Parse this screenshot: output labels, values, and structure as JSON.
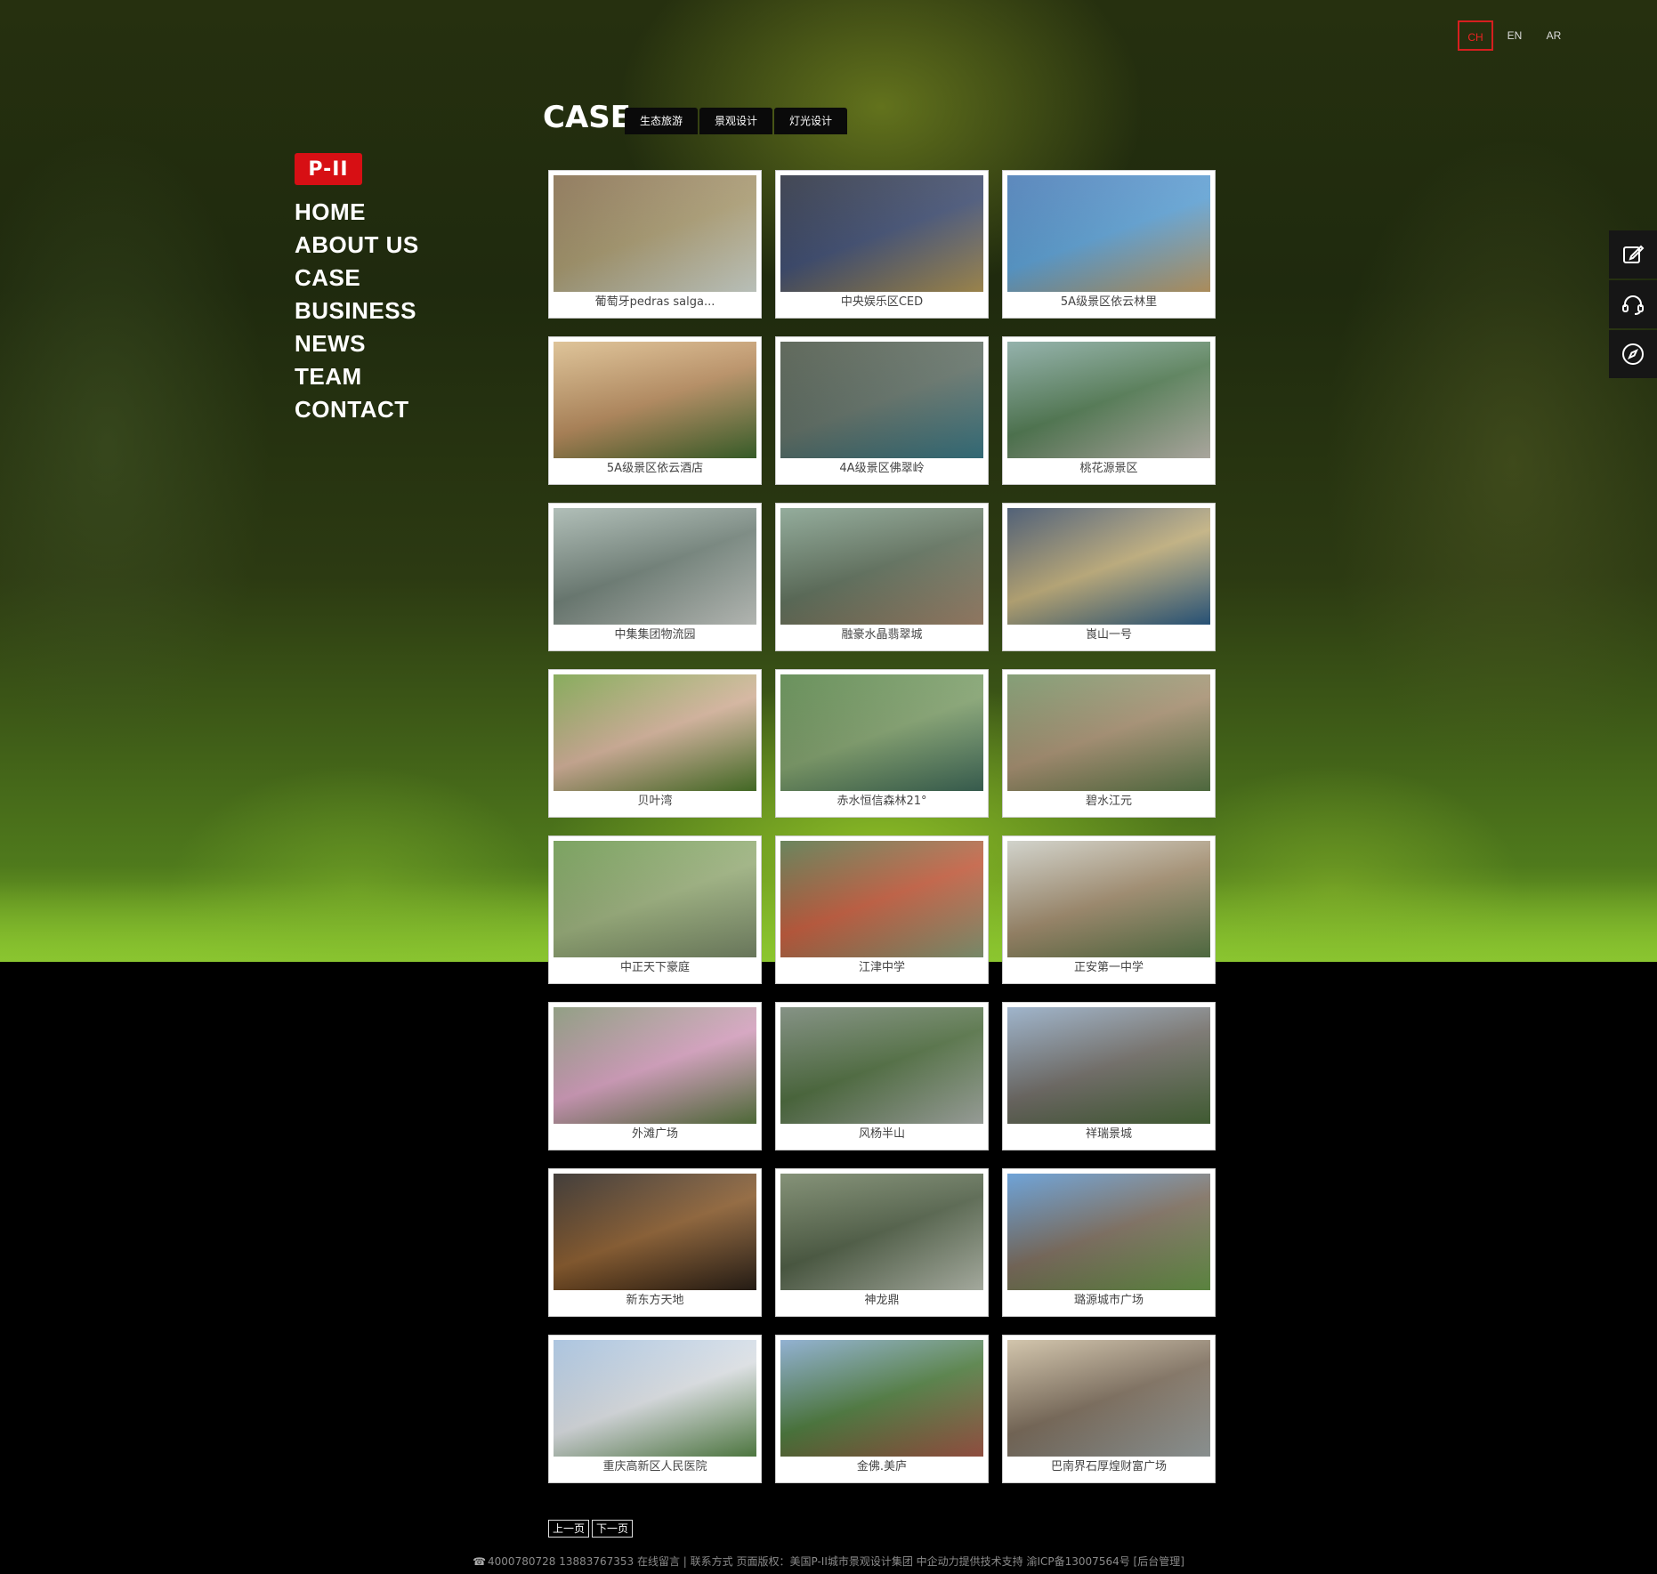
{
  "lang": [
    {
      "label": "CH",
      "active": true
    },
    {
      "label": "EN",
      "active": false
    },
    {
      "label": "AR",
      "active": false
    }
  ],
  "logo": {
    "text": "P-II"
  },
  "nav": {
    "items": [
      "HOME",
      "ABOUT US",
      "CASE",
      "BUSINESS",
      "NEWS",
      "TEAM",
      "CONTACT"
    ]
  },
  "case": {
    "title": "CASE",
    "tabs": [
      "生态旅游",
      "景观设计",
      "灯光设计"
    ]
  },
  "cards": [
    {
      "caption": "葡萄牙pedras salga...",
      "colors": [
        "#7c6240",
        "#a99a6e",
        "#d8e0d8"
      ]
    },
    {
      "caption": "中央娱乐区CED",
      "colors": [
        "#1a2030",
        "#3b4a70",
        "#b59a58"
      ]
    },
    {
      "caption": "5A级景区依云林里",
      "colors": [
        "#3a6fae",
        "#5aa1d7",
        "#c9a46a"
      ]
    },
    {
      "caption": "5A级景区依云酒店",
      "colors": [
        "#d7b783",
        "#b88a5a",
        "#3f6b2f"
      ]
    },
    {
      "caption": "4A级景区佛翠岭",
      "colors": [
        "#3f4a3a",
        "#5e6e64",
        "#3a7a88"
      ]
    },
    {
      "caption": "桃花源景区",
      "colors": [
        "#7da19a",
        "#4f7a50",
        "#c7c2b8"
      ]
    },
    {
      "caption": "中集集团物流园",
      "colors": [
        "#9fb0a8",
        "#6e7f76",
        "#d0d4cf"
      ]
    },
    {
      "caption": "融豪水晶翡翠城",
      "colors": [
        "#7c9a86",
        "#5d6f5a",
        "#a88a70"
      ]
    },
    {
      "caption": "崀山一号",
      "colors": [
        "#2c3f5a",
        "#c3b07a",
        "#2d5f8a"
      ]
    },
    {
      "caption": "贝叶湾",
      "colors": [
        "#6e9a3a",
        "#d7b39a",
        "#4d7a2a"
      ]
    },
    {
      "caption": "赤水恒信森林21°",
      "colors": [
        "#4a7a3a",
        "#7fa06a",
        "#3f6a5a"
      ]
    },
    {
      "caption": "碧水江元",
      "colors": [
        "#6a8a5a",
        "#a89070",
        "#5a7a48"
      ]
    },
    {
      "caption": "中正天下豪庭",
      "colors": [
        "#5f8f3f",
        "#9ab07a",
        "#7a8a6a"
      ]
    },
    {
      "caption": "江津中学",
      "colors": [
        "#4a6a3a",
        "#c65a3a",
        "#8aa07a"
      ]
    },
    {
      "caption": "正安第一中学",
      "colors": [
        "#c7c9c0",
        "#a08a6a",
        "#5a7a4a"
      ]
    },
    {
      "caption": "外滩广场",
      "colors": [
        "#7a8a6a",
        "#d8a0c0",
        "#5a7a40"
      ]
    },
    {
      "caption": "风杨半山",
      "colors": [
        "#6a7a6a",
        "#4a6a3a",
        "#b0b6b0"
      ]
    },
    {
      "caption": "祥瑞景城",
      "colors": [
        "#8aa4c0",
        "#6e6a64",
        "#4a6a3a"
      ]
    },
    {
      "caption": "新东方天地",
      "colors": [
        "#1a1410",
        "#8a5a2a",
        "#2a2018"
      ]
    },
    {
      "caption": "神龙鼎",
      "colors": [
        "#6a7a5a",
        "#4a5a40",
        "#c0c6b8"
      ]
    },
    {
      "caption": "璐源城市广场",
      "colors": [
        "#4f8fcf",
        "#7a6a5a",
        "#6a9a4a"
      ]
    },
    {
      "caption": "重庆高新区人民医院",
      "colors": [
        "#9ab8d8",
        "#e0e4e8",
        "#5a8a4a"
      ]
    },
    {
      "caption": "金佛.美庐",
      "colors": [
        "#7aa0c8",
        "#4a7a3a",
        "#a85a4a"
      ]
    },
    {
      "caption": "巴南界石厚煌财富广场",
      "colors": [
        "#c8b89a",
        "#7a6a58",
        "#a0a8a8"
      ]
    }
  ],
  "tools": [
    {
      "icon": "edit-icon"
    },
    {
      "icon": "headset-icon"
    },
    {
      "icon": "compass-icon"
    }
  ],
  "pager": {
    "prev": "上一页",
    "next": "下一页"
  },
  "footer": {
    "text": "4000780728 13883767353 在线留言 | 联系方式  页面版权：美国P-II城市景观设计集团 中企动力提供技术支持 渝ICP备13007564号 [后台管理]"
  },
  "colors": {
    "accent": "#d70f14",
    "lang_active": "#d61f1f"
  }
}
